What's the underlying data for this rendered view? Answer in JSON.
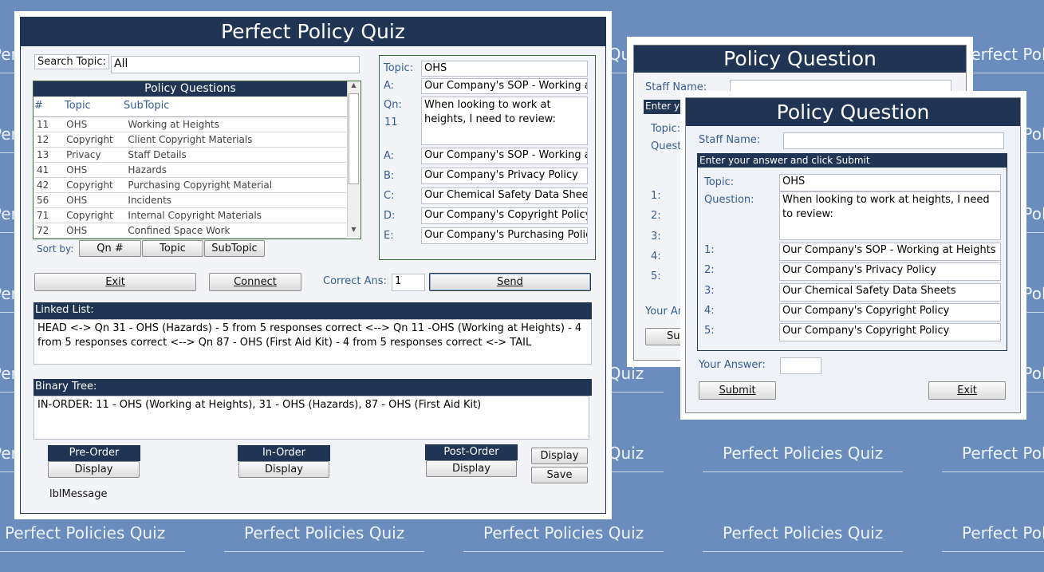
{
  "background": {
    "color": "#6b8dbd",
    "watermark": "Perfect Policies Quiz"
  },
  "main": {
    "title": "Perfect Policy Quiz",
    "search_label": "Search Topic:",
    "search_value": "All",
    "list_title": "Policy Questions",
    "list_headers": [
      "#",
      "Topic",
      "SubTopic"
    ],
    "rows": [
      [
        "11",
        "OHS",
        "Working at Heights"
      ],
      [
        "12",
        "Copyright",
        "Client Copyright Materials"
      ],
      [
        "13",
        "Privacy",
        "Staff Details"
      ],
      [
        "41",
        "OHS",
        "Hazards"
      ],
      [
        "42",
        "Copyright",
        "Purchasing Copyright Material"
      ],
      [
        "56",
        "OHS",
        "Incidents"
      ],
      [
        "71",
        "Copyright",
        "Internal Copyright Materials"
      ],
      [
        "72",
        "OHS",
        "Confined Space Work"
      ]
    ],
    "sort_label": "Sort by:",
    "sort_buttons": [
      "Qn #",
      "Topic",
      "SubTopic"
    ],
    "detail": {
      "topic_label": "Topic:",
      "topic": "OHS",
      "a_label": "A:",
      "a_top": "Our Company's SOP - Working at Heights",
      "qn_label": "Qn:",
      "qn_number": "11",
      "question": "When looking to work at heights, I need to review:",
      "answers": [
        {
          "label": "A:",
          "text": "Our Company's SOP - Working at Heights"
        },
        {
          "label": "B:",
          "text": "Our Company's Privacy Policy"
        },
        {
          "label": "C:",
          "text": "Our Chemical Safety Data Sheets"
        },
        {
          "label": "D:",
          "text": "Our Company's Copyright Policy"
        },
        {
          "label": "E:",
          "text": "Our Company's Purchasing Policy"
        }
      ]
    },
    "exit_label": "Exit",
    "connect_label": "Connect",
    "correct_label": "Correct Ans:",
    "correct_value": "1",
    "send_label": "Send",
    "linked_title": "Linked List:",
    "linked_text": "HEAD <-> Qn 31 - OHS (Hazards) - 5 from 5 responses correct  <--> Qn 11 -OHS (Working at Heights) - 4 from 5 responses correct  <--> Qn 87 - OHS (First Aid Kit) - 4 from 5 responses correct  <-> TAIL",
    "binary_title": "Binary Tree:",
    "binary_text": "IN-ORDER:  11 - OHS (Working at Heights), 31 - OHS (Hazards), 87 - OHS (First Aid Kit)",
    "pre_order": "Pre-Order",
    "in_order": "In-Order",
    "post_order": "Post-Order",
    "display_label": "Display",
    "save_label": "Save",
    "message": "lblMessage"
  },
  "back": {
    "title": "Policy Question",
    "staff_label": "Staff Name:",
    "instruction": "Enter yo",
    "topic_label": "Topic:",
    "question_label": "Quest",
    "nums": [
      "1:",
      "2:",
      "3:",
      "4:",
      "5:"
    ],
    "answer_label": "Your An",
    "submit": "Sub"
  },
  "front": {
    "title": "Policy Question",
    "staff_label": "Staff Name:",
    "staff_value": "",
    "instruction": "Enter your answer and click Submit",
    "topic_label": "Topic:",
    "topic": "OHS",
    "question_label": "Question:",
    "question": "When looking to work at heights, I need to review:",
    "answers": [
      {
        "label": "1:",
        "text": "Our Company's SOP - Working at Heights"
      },
      {
        "label": "2:",
        "text": "Our Company's Privacy Policy"
      },
      {
        "label": "3:",
        "text": "Our Chemical Safety Data Sheets"
      },
      {
        "label": "4:",
        "text": "Our Company's Copyright Policy"
      },
      {
        "label": "5:",
        "text": "Our Company's Copyright Policy"
      }
    ],
    "your_answer_label": "Your Answer:",
    "your_answer": "",
    "submit_label": "Submit",
    "exit_label": "Exit"
  }
}
